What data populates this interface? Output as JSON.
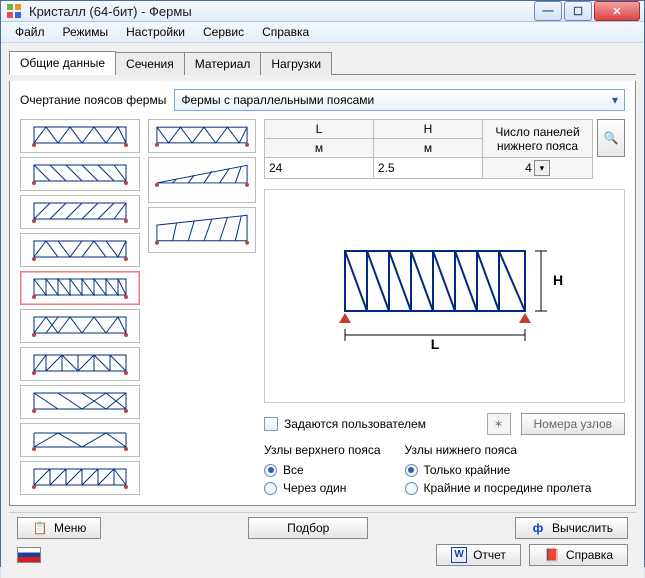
{
  "window": {
    "title": "Кристалл (64-бит) - Фермы"
  },
  "menu": {
    "file": "Файл",
    "modes": "Режимы",
    "settings": "Настройки",
    "service": "Сервис",
    "help": "Справка"
  },
  "tabs": {
    "general": "Общие данные",
    "sections": "Сечения",
    "material": "Материал",
    "loads": "Нагрузки"
  },
  "form": {
    "chord_outline_label": "Очертание поясов фермы",
    "chord_type_value": "Фермы с параллельными поясами"
  },
  "table": {
    "col_L": "L",
    "col_H": "H",
    "col_panels": "Число панелей нижнего пояса",
    "unit_m": "м",
    "val_L": "24",
    "val_H": "2.5",
    "val_panels": "4"
  },
  "preview": {
    "L_label": "L",
    "H_label": "H"
  },
  "options": {
    "user_defined": "Задаются пользователем",
    "node_numbers": "Номера узлов",
    "top_nodes_title": "Узлы верхнего пояса",
    "bottom_nodes_title": "Узлы нижнего пояса",
    "top_all": "Все",
    "top_alt": "Через один",
    "bot_ends": "Только крайние",
    "bot_mid": "Крайние и посредине пролета"
  },
  "buttons": {
    "menu": "Меню",
    "select": "Подбор",
    "compute": "Вычислить",
    "report": "Отчет",
    "help": "Справка"
  }
}
